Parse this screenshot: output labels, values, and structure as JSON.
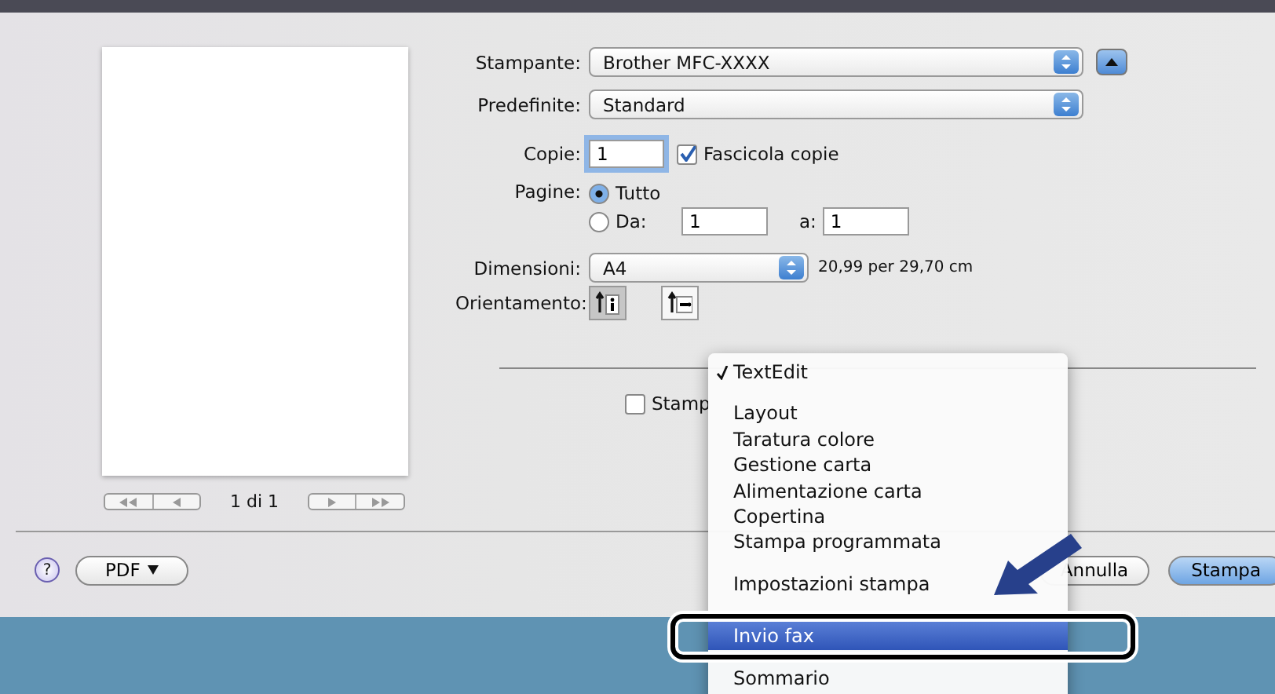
{
  "preview": {
    "page_count": "1 di 1"
  },
  "printer": {
    "label": "Stampante:",
    "value": "Brother MFC-XXXX"
  },
  "presets": {
    "label": "Predefinite:",
    "value": "Standard"
  },
  "copies": {
    "label": "Copie:",
    "value": "1",
    "collate": {
      "label": "Fascicola copie",
      "checked": true
    }
  },
  "pages": {
    "label": "Pagine:",
    "options": [
      {
        "label": "Tutto",
        "selected": true
      },
      {
        "label": "Da:",
        "selected": false
      }
    ],
    "from": "1",
    "to_label": "a:",
    "to": "1"
  },
  "paper_size": {
    "label": "Dimensioni:",
    "value": "A4",
    "note": "20,99 per 29,70 cm"
  },
  "orientation": {
    "label": "Orientamento:",
    "options": [
      {
        "kind": "portrait",
        "selected": true
      },
      {
        "kind": "landscape",
        "selected": false
      }
    ]
  },
  "header_footer": {
    "label": "Stamp",
    "checked": false
  },
  "menu": {
    "items": [
      {
        "kind": "item",
        "label": "TextEdit",
        "checked": true,
        "selected": false
      },
      {
        "kind": "separator"
      },
      {
        "kind": "item",
        "label": "Layout",
        "checked": false,
        "selected": false
      },
      {
        "kind": "item",
        "label": "Taratura colore",
        "checked": false,
        "selected": false
      },
      {
        "kind": "item",
        "label": "Gestione carta",
        "checked": false,
        "selected": false
      },
      {
        "kind": "item",
        "label": "Alimentazione carta",
        "checked": false,
        "selected": false
      },
      {
        "kind": "item",
        "label": "Copertina",
        "checked": false,
        "selected": false
      },
      {
        "kind": "item",
        "label": "Stampa programmata",
        "checked": false,
        "selected": false
      },
      {
        "kind": "separator"
      },
      {
        "kind": "item",
        "label": "Impostazioni stampa",
        "checked": false,
        "selected": false
      },
      {
        "kind": "item",
        "label": "Invio fax",
        "checked": false,
        "selected": true
      },
      {
        "kind": "separator"
      },
      {
        "kind": "item",
        "label": "Sommario",
        "checked": false,
        "selected": false
      }
    ]
  },
  "buttons": {
    "help": "?",
    "pdf": "PDF",
    "cancel": "Annulla",
    "print": "Stampa"
  }
}
